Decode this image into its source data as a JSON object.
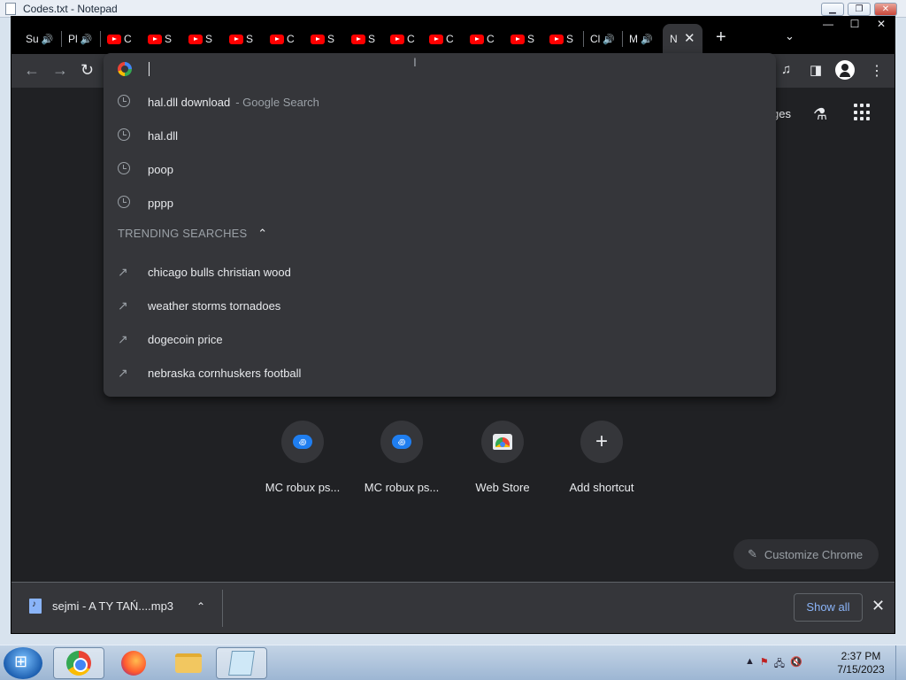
{
  "notepad": {
    "title": "Codes.txt - Notepad",
    "minimize": "▁",
    "maximize": "❐",
    "close": "✕"
  },
  "chrome": {
    "tabs": [
      {
        "label": "Su",
        "icon": "speaker-icon",
        "audio": true
      },
      {
        "label": "Pl",
        "icon": "speaker-icon",
        "audio": true
      },
      {
        "label": "C",
        "icon": "youtube-icon"
      },
      {
        "label": "S",
        "icon": "youtube-icon"
      },
      {
        "label": "S",
        "icon": "youtube-icon"
      },
      {
        "label": "S",
        "icon": "youtube-icon"
      },
      {
        "label": "C",
        "icon": "youtube-icon"
      },
      {
        "label": "S",
        "icon": "youtube-icon"
      },
      {
        "label": "S",
        "icon": "youtube-icon"
      },
      {
        "label": "C",
        "icon": "youtube-icon"
      },
      {
        "label": "C",
        "icon": "youtube-icon"
      },
      {
        "label": "C",
        "icon": "youtube-icon"
      },
      {
        "label": "S",
        "icon": "youtube-icon"
      },
      {
        "label": "S",
        "icon": "youtube-icon"
      },
      {
        "label": "Cl",
        "icon": "speaker-icon",
        "audio": true
      },
      {
        "label": "M",
        "icon": "speaker-icon",
        "audio": true
      }
    ],
    "active_tab": {
      "label": "N",
      "close": "✕"
    },
    "new_tab": "+",
    "tab_search": "⌄",
    "window": {
      "minimize": "—",
      "maximize": "☐",
      "close": "✕"
    },
    "toolbar": {
      "back": "←",
      "forward": "→",
      "reload": "↻",
      "media": "♫",
      "sidepanel": "◨",
      "menu": "⋮"
    },
    "omnibox": {
      "input_value": "",
      "history": [
        {
          "text": "hal.dll download",
          "sub": "- Google Search"
        },
        {
          "text": "hal.dll",
          "sub": ""
        },
        {
          "text": "poop",
          "sub": ""
        },
        {
          "text": "pppp",
          "sub": ""
        }
      ],
      "trending_header": "TRENDING SEARCHES",
      "trending_chevron": "⌃",
      "trending": [
        {
          "text": "chicago bulls christian wood"
        },
        {
          "text": "weather storms tornadoes"
        },
        {
          "text": "dogecoin price"
        },
        {
          "text": "nebraska cornhuskers football"
        }
      ],
      "trend_glyph": "↗"
    },
    "ntp": {
      "images_link": "ges",
      "labs_glyph": "⚗",
      "shortcuts": [
        {
          "label": "MC robux ps...",
          "icon": "mc-icon",
          "glyph": "꩜"
        },
        {
          "label": "MC robux ps...",
          "icon": "mc-icon",
          "glyph": "꩜"
        },
        {
          "label": "Web Store",
          "icon": "webstore-icon"
        },
        {
          "label": "Add shortcut",
          "icon": "plus-icon",
          "glyph": "+"
        }
      ],
      "customize_label": "Customize Chrome",
      "customize_glyph": "✎"
    },
    "downloads": {
      "file_name": "sejmi - A TY TAŃ....mp3",
      "chevron": "⌃",
      "show_all": "Show all",
      "close": "✕"
    }
  },
  "taskbar": {
    "time": "2:37 PM",
    "date": "7/15/2023",
    "tray_up": "▲",
    "tray_flag": "⚑",
    "tray_net": "🖧",
    "tray_vol": "🔇"
  }
}
